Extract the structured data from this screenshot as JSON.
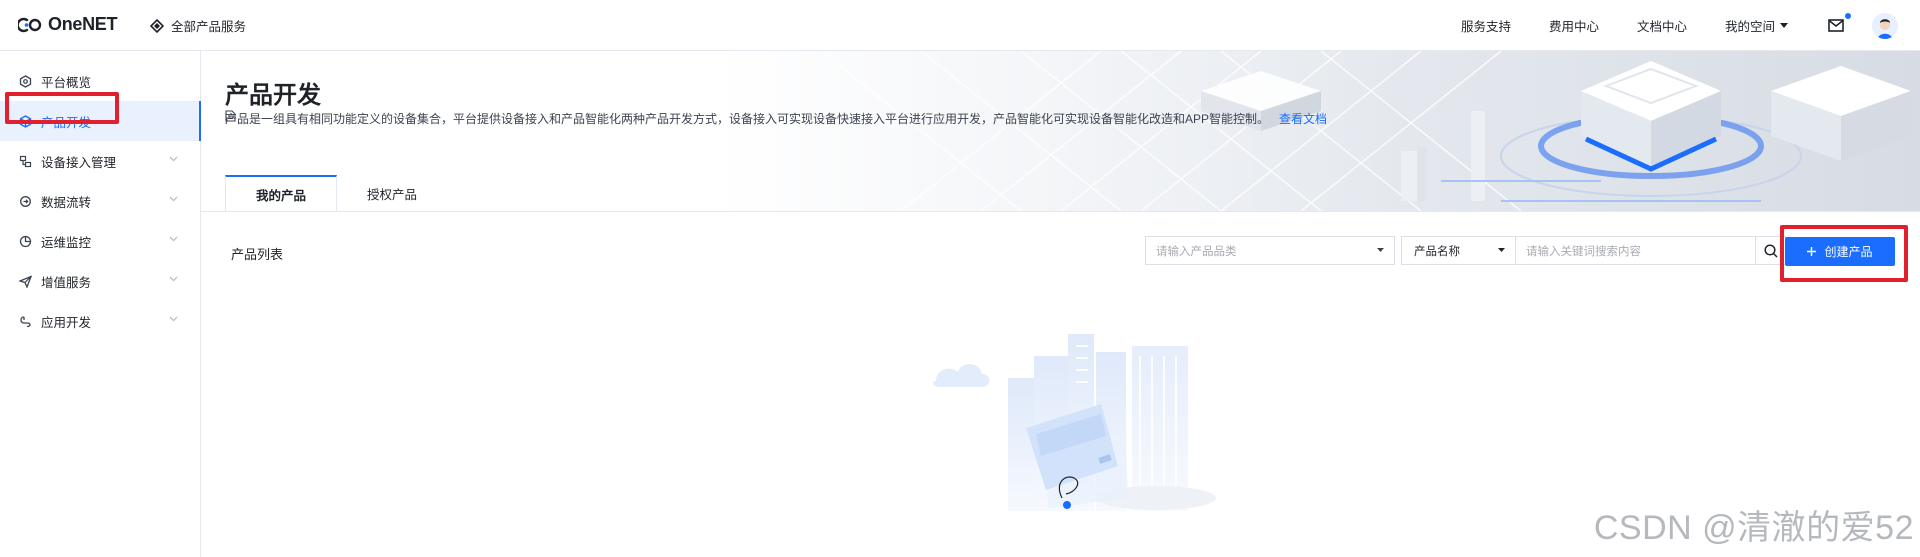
{
  "app": {
    "logo_text": "OneNET",
    "all_products": "全部产品服务"
  },
  "topnav": {
    "items": [
      "服务支持",
      "费用中心",
      "文档中心"
    ],
    "my_space": "我的空间"
  },
  "sidebar": {
    "items": [
      {
        "label": "平台概览",
        "icon": "overview-icon"
      },
      {
        "label": "产品开发",
        "icon": "cube-icon"
      },
      {
        "label": "设备接入管理",
        "icon": "device-icon"
      },
      {
        "label": "数据流转",
        "icon": "dataflow-icon"
      },
      {
        "label": "运维监控",
        "icon": "monitor-icon"
      },
      {
        "label": "增值服务",
        "icon": "send-icon"
      },
      {
        "label": "应用开发",
        "icon": "app-dev-icon"
      }
    ]
  },
  "page": {
    "title": "产品开发",
    "description": "产品是一组具有相同功能定义的设备集合，平台提供设备接入和产品智能化两种产品开发方式，设备接入可实现设备快速接入平台进行应用开发，产品智能化可实现设备智能化改造和APP智能控制。",
    "doc_link": "查看文档"
  },
  "tabs": [
    {
      "label": "我的产品",
      "active": true
    },
    {
      "label": "授权产品",
      "active": false
    }
  ],
  "list": {
    "title": "产品列表",
    "category_placeholder": "请输入产品品类",
    "search_field": "产品名称",
    "search_placeholder": "请输入关键词搜索内容",
    "create_button": "创建产品"
  },
  "watermark": "CSDN @清澈的爱52",
  "colors": {
    "accent": "#1a6dff",
    "highlight_box": "#e0202c"
  }
}
